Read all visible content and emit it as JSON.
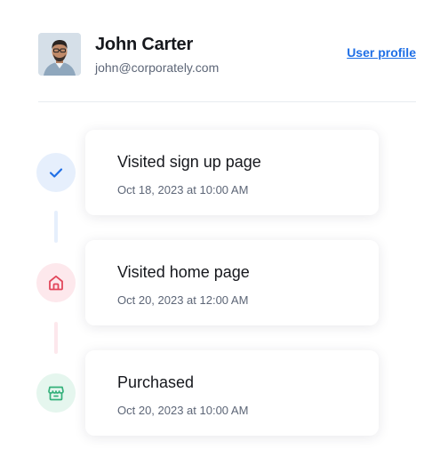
{
  "user": {
    "name": "John Carter",
    "email": "john@corporately.com",
    "profile_link": "User profile",
    "avatar_icon": "user-avatar"
  },
  "colors": {
    "link": "#1f6fe6",
    "visited_signup": "#1f6fe6",
    "visited_home": "#e2475b",
    "purchased": "#33b07a"
  },
  "timeline": [
    {
      "title": "Visited sign up page",
      "time": "Oct 18, 2023 at 10:00 AM",
      "icon": "check-icon"
    },
    {
      "title": "Visited home page",
      "time": "Oct 20, 2023 at 12:00 AM",
      "icon": "home-icon"
    },
    {
      "title": "Purchased",
      "time": "Oct 20, 2023 at 10:00 AM",
      "icon": "store-icon"
    }
  ]
}
